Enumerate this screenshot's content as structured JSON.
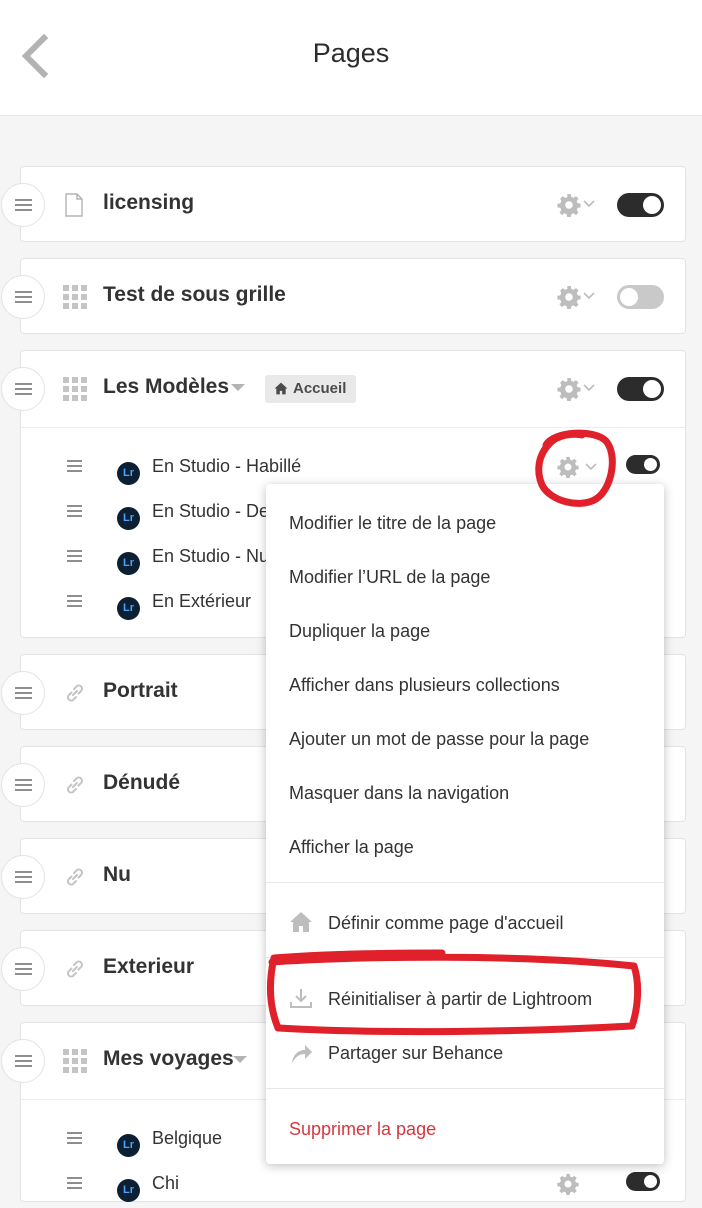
{
  "header": {
    "title": "Pages"
  },
  "pages": [
    {
      "name": "licensing",
      "icon": "page-icon",
      "enabled": true
    },
    {
      "name": "Test de sous grille",
      "icon": "grid-icon",
      "enabled": false
    },
    {
      "name": "Les Modèles",
      "icon": "grid-icon",
      "enabled": true,
      "badge": "Accueil",
      "children": [
        {
          "name": "En Studio - Habillé",
          "badge": "Lr",
          "enabled": true
        },
        {
          "name": "En Studio - De",
          "badge": "Lr"
        },
        {
          "name": "En Studio - Nu",
          "badge": "Lr"
        },
        {
          "name": "En Extérieur",
          "badge": "Lr"
        }
      ]
    },
    {
      "name": "Portrait",
      "icon": "link-icon"
    },
    {
      "name": "Dénudé",
      "icon": "link-icon"
    },
    {
      "name": "Nu",
      "icon": "link-icon"
    },
    {
      "name": "Exterieur",
      "icon": "link-icon"
    },
    {
      "name": "Mes voyages",
      "icon": "grid-icon",
      "children": [
        {
          "name": "Belgique",
          "badge": "Lr"
        },
        {
          "name": "Chi",
          "badge": "Lr",
          "enabled": true
        }
      ]
    }
  ],
  "context_menu": {
    "items": [
      "Modifier le titre de la page",
      "Modifier l’URL de la page",
      "Dupliquer la page",
      "Afficher dans plusieurs collections",
      "Ajouter un mot de passe pour la page",
      "Masquer dans la navigation",
      "Afficher la page"
    ],
    "set_home": "Définir comme page d'accueil",
    "reset_lightroom": "Réinitialiser à partir de Lightroom",
    "share_behance": "Partager sur Behance",
    "delete": "Supprimer la page"
  },
  "colors": {
    "toggle_on": "#2c2c2c",
    "toggle_off": "#c9c9c9",
    "delete": "#d7373f",
    "annotation": "#e0202a",
    "lightroom_badge": "#0c1f33"
  }
}
